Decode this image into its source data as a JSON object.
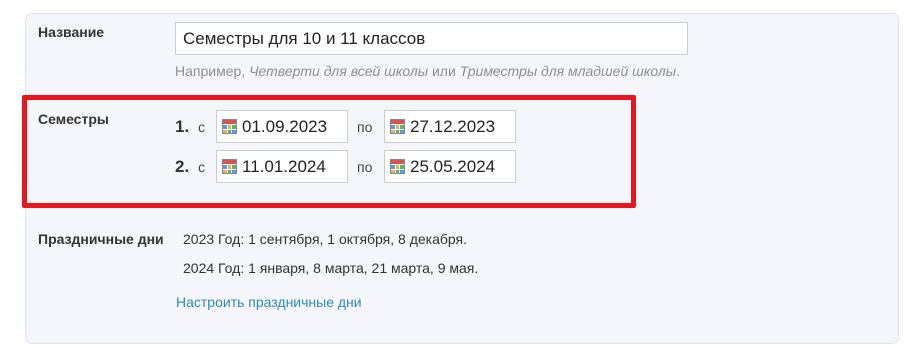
{
  "form": {
    "name_label": "Название",
    "name_value": "Семестры для 10 и 11 классов",
    "hint_prefix": "Например, ",
    "hint_example1": "Четверти для всей школы",
    "hint_or": " или ",
    "hint_example2": "Триместры для младшей школы",
    "hint_suffix": ".",
    "semesters_label": "Семестры",
    "from_word": "с",
    "to_word": "по",
    "semesters": [
      {
        "number": "1.",
        "start": "01.09.2023",
        "end": "27.12.2023"
      },
      {
        "number": "2.",
        "start": "11.01.2024",
        "end": "25.05.2024"
      }
    ],
    "holidays_label": "Праздничные дни",
    "holidays": [
      "2023 Год: 1 сентября, 1 октября, 8 декабря.",
      "2024 Год: 1 января, 8 марта, 21 марта, 9 мая."
    ],
    "holidays_link": "Настроить праздничные дни"
  },
  "colors": {
    "highlight": "#e8161d",
    "link": "#2e8ab3",
    "panel_bg": "#f4f6fb"
  },
  "icons": {
    "date_picker": "calendar-icon"
  }
}
